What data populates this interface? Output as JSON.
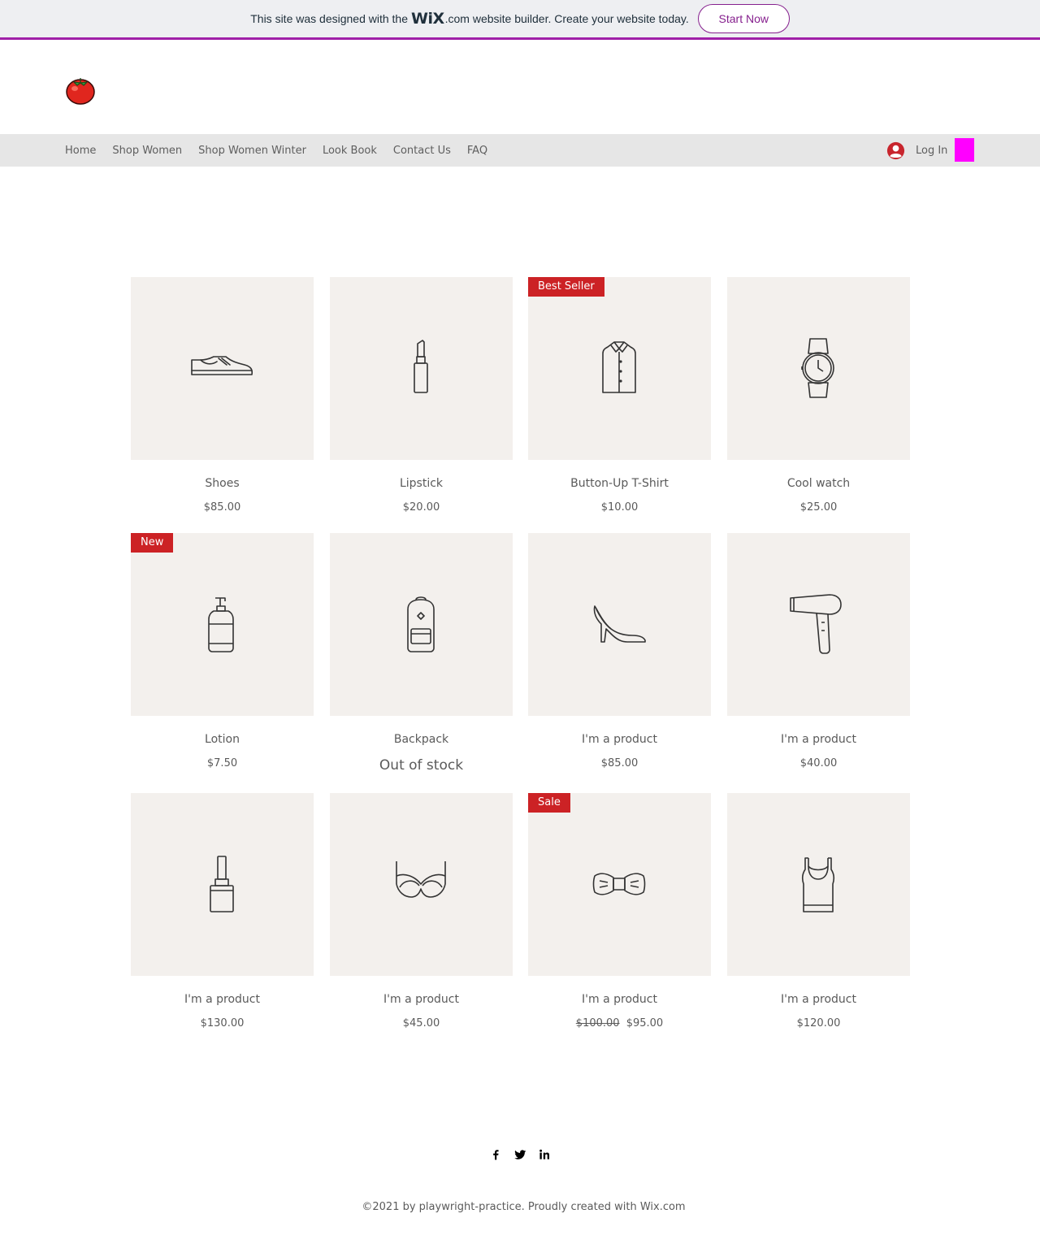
{
  "wix_banner": {
    "text_before": "This site was designed with the",
    "logo": "WiX",
    "text_after": ".com website builder. Create your website today.",
    "button_label": "Start Now",
    "accent_color": "#86208e"
  },
  "header": {
    "logo_icon": "tomato-icon"
  },
  "nav": {
    "items": [
      {
        "label": "Home"
      },
      {
        "label": "Shop Women"
      },
      {
        "label": "Shop Women Winter"
      },
      {
        "label": "Look Book"
      },
      {
        "label": "Contact Us"
      },
      {
        "label": "FAQ"
      }
    ],
    "login_label": "Log In",
    "login_icon": "user-avatar-icon",
    "cart_color": "#ff00ff"
  },
  "products": [
    {
      "name": "Shoes",
      "price": "$85.00",
      "icon": "shoe-icon",
      "ribbon": ""
    },
    {
      "name": "Lipstick",
      "price": "$20.00",
      "icon": "lipstick-icon",
      "ribbon": ""
    },
    {
      "name": "Button-Up T-Shirt",
      "price": "$10.00",
      "icon": "shirt-icon",
      "ribbon": "Best Seller"
    },
    {
      "name": "Cool watch",
      "price": "$25.00",
      "icon": "watch-icon",
      "ribbon": ""
    },
    {
      "name": "Lotion",
      "price": "$7.50",
      "icon": "lotion-icon",
      "ribbon": "New"
    },
    {
      "name": "Backpack",
      "price": "",
      "status": "Out of stock",
      "icon": "backpack-icon",
      "ribbon": ""
    },
    {
      "name": "I'm a product",
      "price": "$85.00",
      "icon": "high-heel-icon",
      "ribbon": ""
    },
    {
      "name": "I'm a product",
      "price": "$40.00",
      "icon": "hair-dryer-icon",
      "ribbon": ""
    },
    {
      "name": "I'm a product",
      "price": "$130.00",
      "icon": "nail-polish-icon",
      "ribbon": ""
    },
    {
      "name": "I'm a product",
      "price": "$45.00",
      "icon": "bra-icon",
      "ribbon": ""
    },
    {
      "name": "I'm a product",
      "old_price": "$100.00",
      "price": "$95.00",
      "icon": "bow-tie-icon",
      "ribbon": "Sale"
    },
    {
      "name": "I'm a product",
      "price": "$120.00",
      "icon": "tank-top-icon",
      "ribbon": ""
    }
  ],
  "ribbon_color": "#cc2225",
  "footer": {
    "social": [
      {
        "icon": "facebook-icon"
      },
      {
        "icon": "twitter-icon"
      },
      {
        "icon": "linkedin-icon"
      }
    ],
    "copyright": "©2021 by playwright-practice. Proudly created with Wix.com"
  }
}
